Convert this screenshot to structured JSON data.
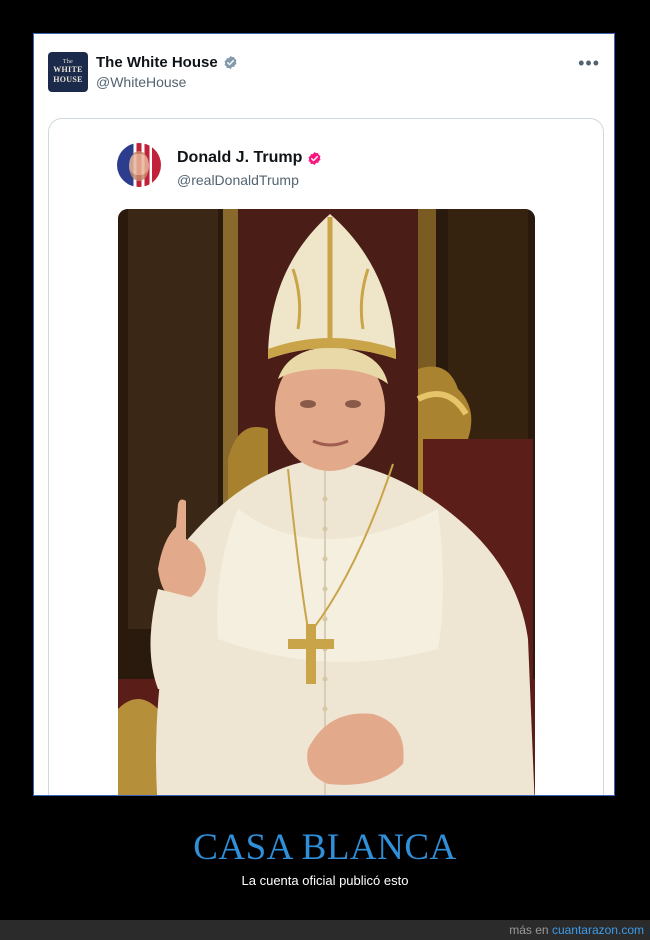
{
  "tweet": {
    "account_name": "The White House",
    "account_handle": "@WhiteHouse",
    "avatar_text": [
      "The",
      "WHITE",
      "HOUSE"
    ],
    "more_label": "•••",
    "verified_color": "#829aab"
  },
  "quoted_tweet": {
    "account_name": "Donald J. Trump",
    "account_handle": "@realDonaldTrump",
    "verified_color": "#f91880",
    "image_description_icon": "pope-portrait-image"
  },
  "caption": {
    "title": "CASA BLANCA",
    "subtitle": "La cuenta oficial publicó esto"
  },
  "footer": {
    "prefix": "más en",
    "site": "cuantarazon.com"
  },
  "colors": {
    "title": "#2f8fd8",
    "border": "#3a63b8",
    "link": "#3d9be9"
  }
}
